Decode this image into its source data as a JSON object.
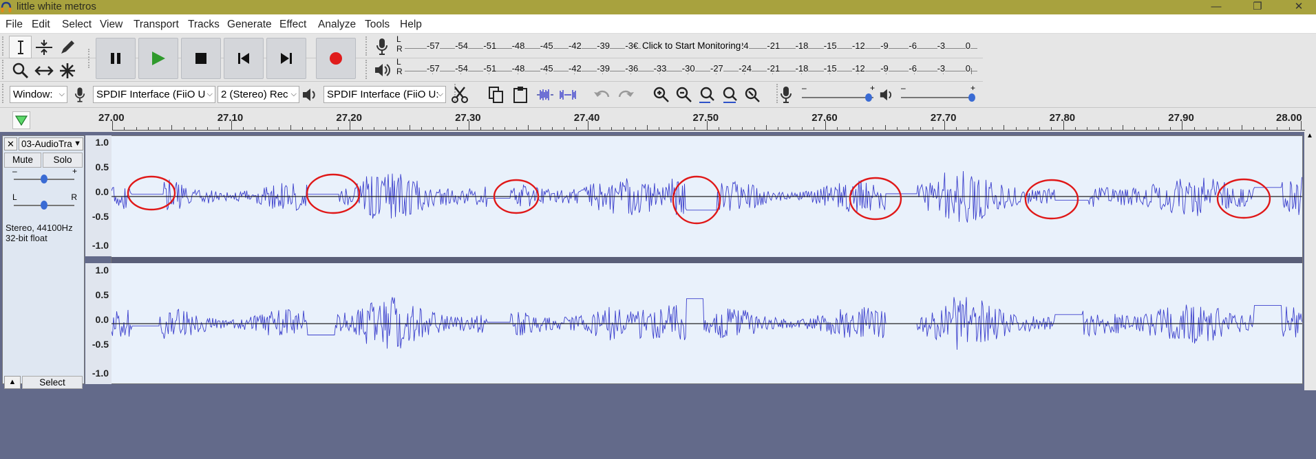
{
  "window": {
    "title": "little white metros",
    "minimize_icon": "minimize-icon",
    "restore_icon": "restore-icon",
    "close_icon": "close-icon"
  },
  "menu": {
    "items": [
      "File",
      "Edit",
      "Select",
      "View",
      "Transport",
      "Tracks",
      "Generate",
      "Effect",
      "Analyze",
      "Tools",
      "Help"
    ]
  },
  "tools": [
    "selection-tool-icon",
    "envelope-tool-icon",
    "draw-tool-icon",
    "zoom-tool-icon",
    "timeshift-tool-icon",
    "multi-tool-icon"
  ],
  "transport": [
    "pause-icon",
    "play-icon",
    "stop-icon",
    "skip-start-icon",
    "skip-end-icon",
    "record-icon"
  ],
  "meters": {
    "ticks": [
      "-57",
      "-54",
      "-51",
      "-48",
      "-45",
      "-42",
      "-39",
      "-36",
      "-33",
      "-30",
      "-27",
      "-24",
      "-21",
      "-18",
      "-15",
      "-12",
      "-9",
      "-6",
      "-3",
      "0"
    ],
    "record_ticks_left": [
      "-57",
      "-54",
      "-51",
      "-48",
      "-45",
      "-42",
      "-39",
      "-3€"
    ],
    "record_ticks_right": [
      "24",
      "-21",
      "-18",
      "-15",
      "-12",
      "-9",
      "-6",
      "-3",
      "0"
    ],
    "record_message": "Click to Start Monitoring",
    "channel_l": "L",
    "channel_r": "R"
  },
  "device": {
    "host": "Window:",
    "recording_device": "SPDIF Interface (FiiO U",
    "channels": "2 (Stereo) Rec",
    "playback_device": "SPDIF Interface (FiiO U:"
  },
  "timeline": {
    "labels": [
      "27.00",
      "27.10",
      "27.20",
      "27.30",
      "27.40",
      "27.50",
      "27.60",
      "27.70",
      "27.80",
      "27.90",
      "28.00"
    ]
  },
  "track": {
    "name": "03-AudioTra",
    "mute": "Mute",
    "solo": "Solo",
    "gain_minus": "–",
    "gain_plus": "+",
    "pan_l": "L",
    "pan_r": "R",
    "format_line1": "Stereo, 44100Hz",
    "format_line2": "32-bit float",
    "select": "Select",
    "close": "✕",
    "collapse": "▲",
    "vruler": [
      "1.0",
      "0.5",
      "0.0",
      "-0.5",
      "-1.0"
    ]
  },
  "colors": {
    "waveform": "#3b3fcc",
    "annotation": "#e01818",
    "track_bg": "#e9f1fb"
  }
}
